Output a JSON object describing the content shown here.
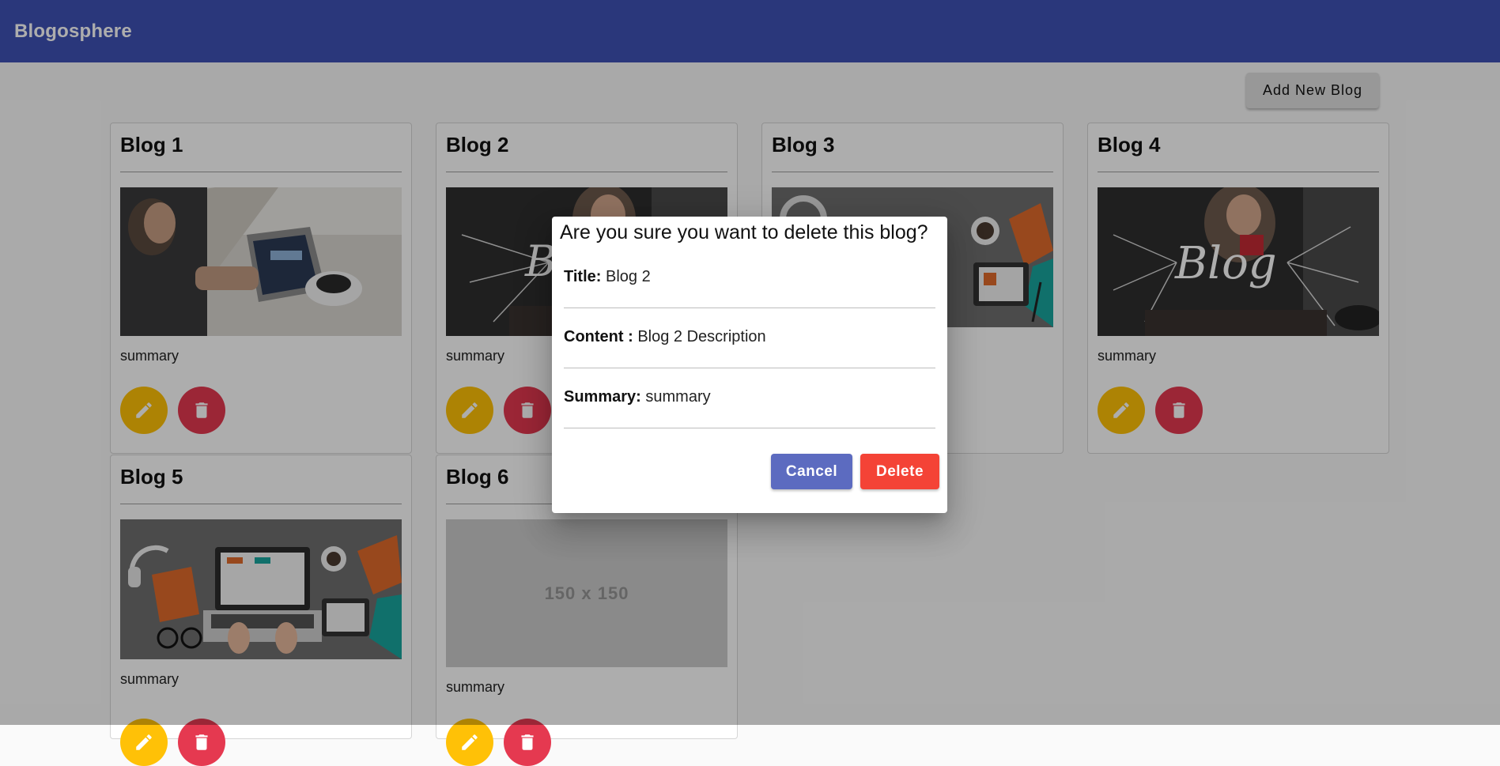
{
  "app": {
    "title": "Blogosphere"
  },
  "toolbar": {
    "add_label": "Add New Blog"
  },
  "blogs": [
    {
      "title": "Blog 1",
      "summary": "summary",
      "image": "man-with-tablet-and-coffee"
    },
    {
      "title": "Blog 2",
      "summary": "summary",
      "image": "blog-woman-cafe"
    },
    {
      "title": "Blog 3",
      "summary": "summary",
      "image": "desk-laptop-flatlay"
    },
    {
      "title": "Blog 4",
      "summary": "summary",
      "image": "blog-woman-cafe"
    },
    {
      "title": "Blog 5",
      "summary": "summary",
      "image": "desk-laptop-flatlay"
    },
    {
      "title": "Blog 6",
      "summary": "summary",
      "image": "placeholder",
      "placeholder_text": "150 x 150"
    }
  ],
  "icons": {
    "edit": "pencil-icon",
    "delete": "trash-icon"
  },
  "colors": {
    "primary": "#3f51b5",
    "edit": "#ffc107",
    "delete": "#e53950",
    "cancel": "#5c6bc0",
    "danger": "#f44336"
  },
  "dialog": {
    "title": "Are you sure you want to delete this blog?",
    "title_label": "Title:",
    "title_value": "Blog 2",
    "content_label": "Content :",
    "content_value": "Blog 2 Description",
    "summary_label": "Summary:",
    "summary_value": "summary",
    "cancel_label": "Cancel",
    "delete_label": "Delete"
  }
}
